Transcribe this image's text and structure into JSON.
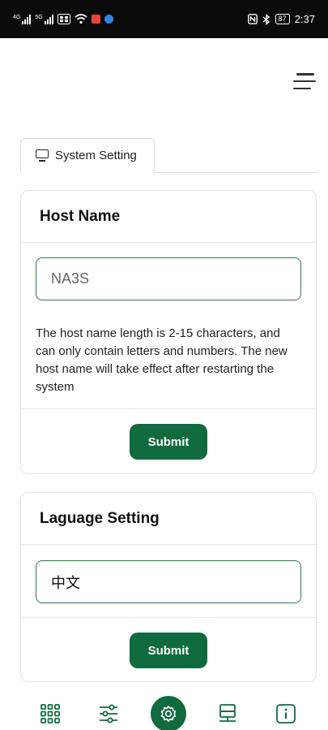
{
  "status_bar": {
    "network_1": "4G",
    "network_2": "5G",
    "time": "2:37",
    "battery": "87"
  },
  "header": {
    "menu_icon": "hamburger-menu-icon"
  },
  "tabs": [
    {
      "label": "System Setting",
      "icon": "monitor-icon"
    }
  ],
  "host_name": {
    "title": "Host Name",
    "input_placeholder": "NA3S",
    "hint": "The host name length is 2-15 characters, and can only contain letters and numbers. The new host name will take effect after restarting the system",
    "submit_label": "Submit"
  },
  "language": {
    "title": "Laguage Setting",
    "selected_value": "中文",
    "submit_label": "Submit"
  },
  "bottom_nav": [
    {
      "icon": "grid-icon"
    },
    {
      "icon": "sliders-icon"
    },
    {
      "icon": "settings-gear-icon",
      "active": true
    },
    {
      "icon": "network-icon"
    },
    {
      "icon": "info-icon"
    }
  ],
  "colors": {
    "accent": "#0f6b3d",
    "input_border": "#2f7a45",
    "status_bar": "#0b0b0b"
  }
}
